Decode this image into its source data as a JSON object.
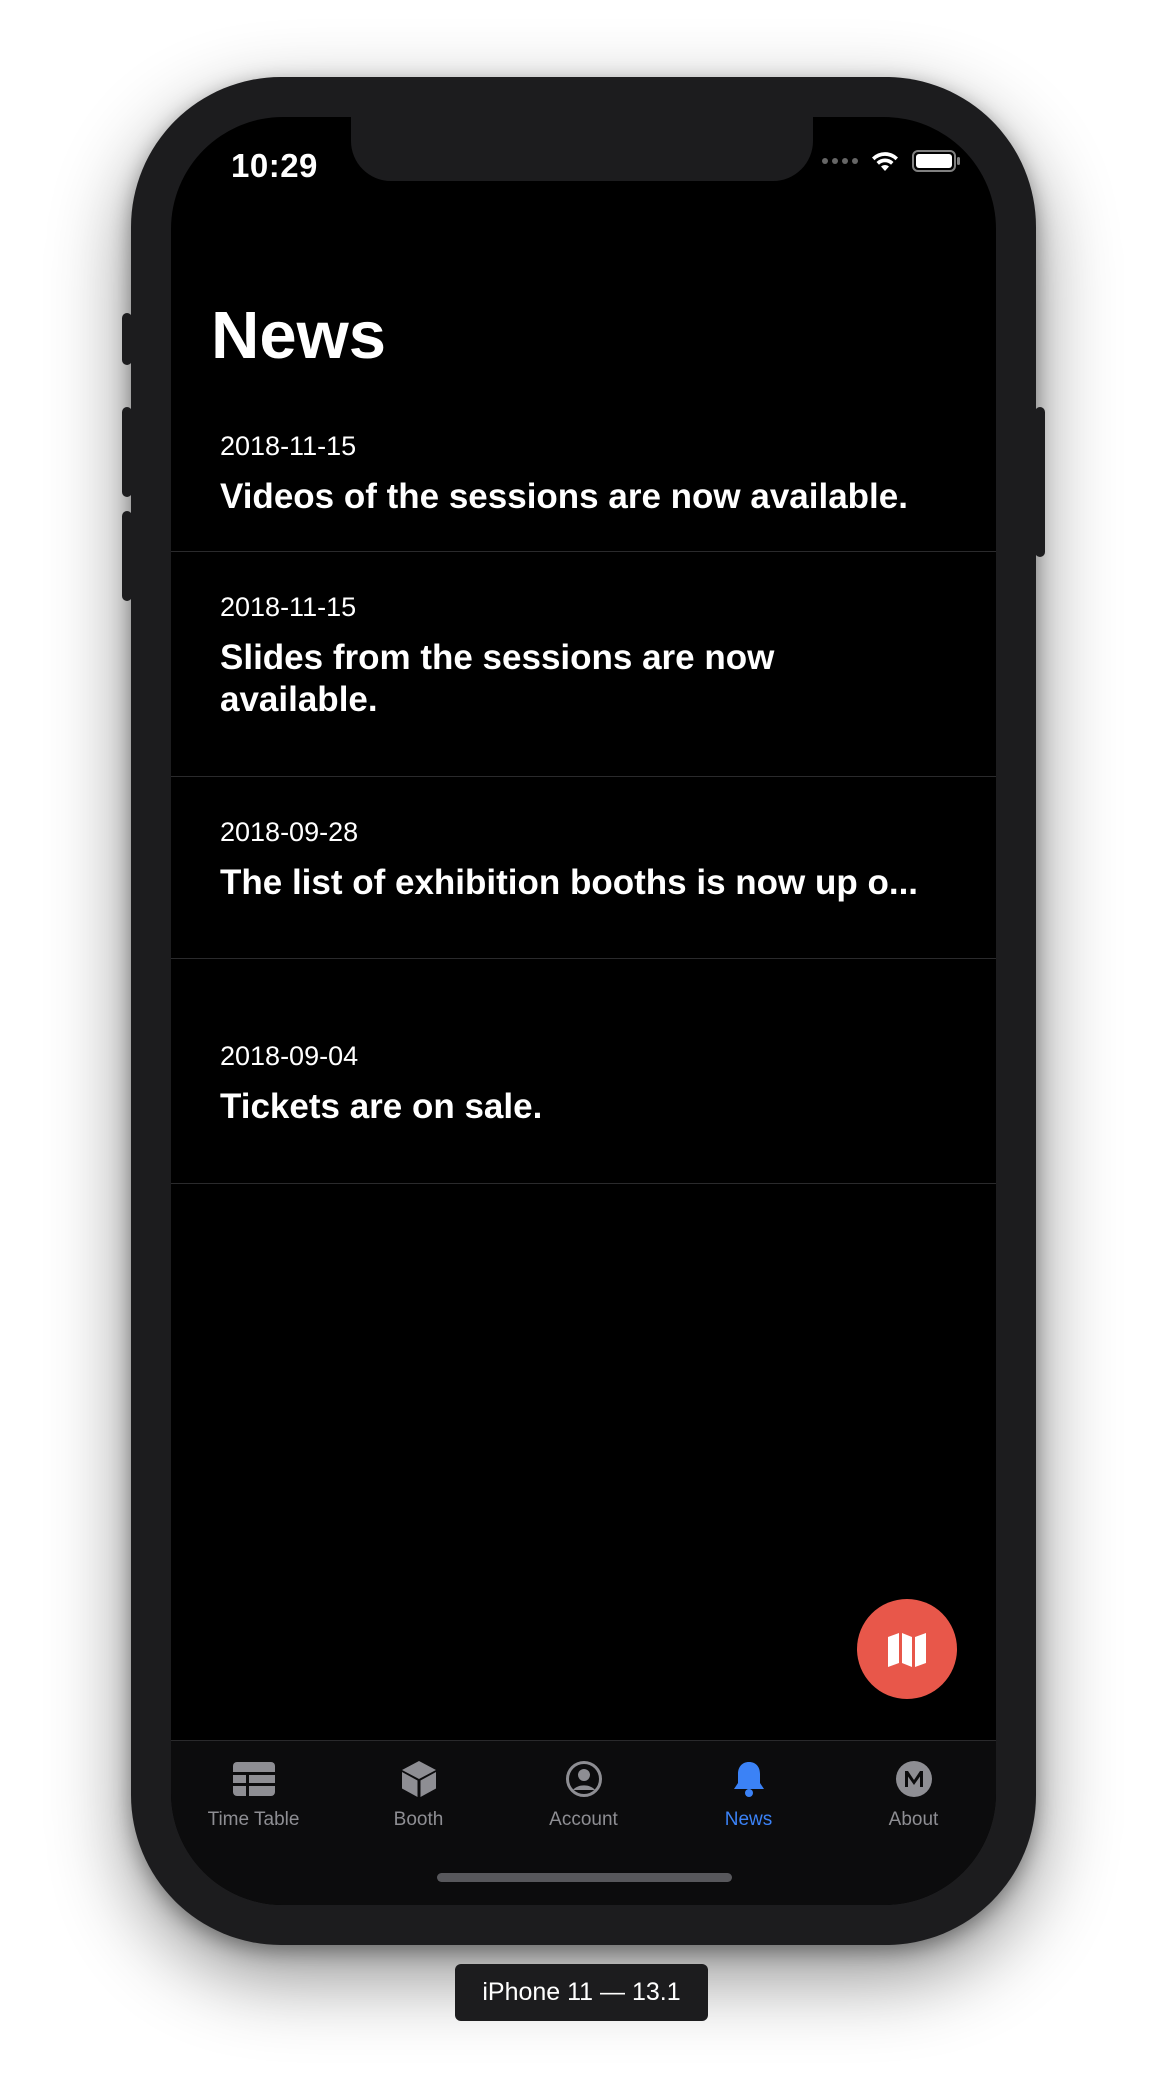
{
  "status_bar": {
    "time": "10:29"
  },
  "header": {
    "title": "News"
  },
  "news": [
    {
      "date": "2018-11-15",
      "title": "Videos of the sessions are now available."
    },
    {
      "date": "2018-11-15",
      "title": "Slides from the sessions are now available."
    },
    {
      "date": "2018-09-28",
      "title": "The list of exhibition booths is now up o..."
    },
    {
      "date": "2018-09-04",
      "title": "Tickets are on sale."
    }
  ],
  "fab": {
    "icon": "map-icon",
    "color": "#e8574a"
  },
  "tab_bar": {
    "active": "News",
    "active_color": "#3b82f6",
    "tabs": [
      {
        "label": "Time Table",
        "icon": "table-icon"
      },
      {
        "label": "Booth",
        "icon": "cube-icon"
      },
      {
        "label": "Account",
        "icon": "user-circle-icon"
      },
      {
        "label": "News",
        "icon": "bell-icon"
      },
      {
        "label": "About",
        "icon": "m-logo-icon"
      }
    ]
  },
  "simulator": {
    "label": "iPhone 11 — 13.1"
  }
}
